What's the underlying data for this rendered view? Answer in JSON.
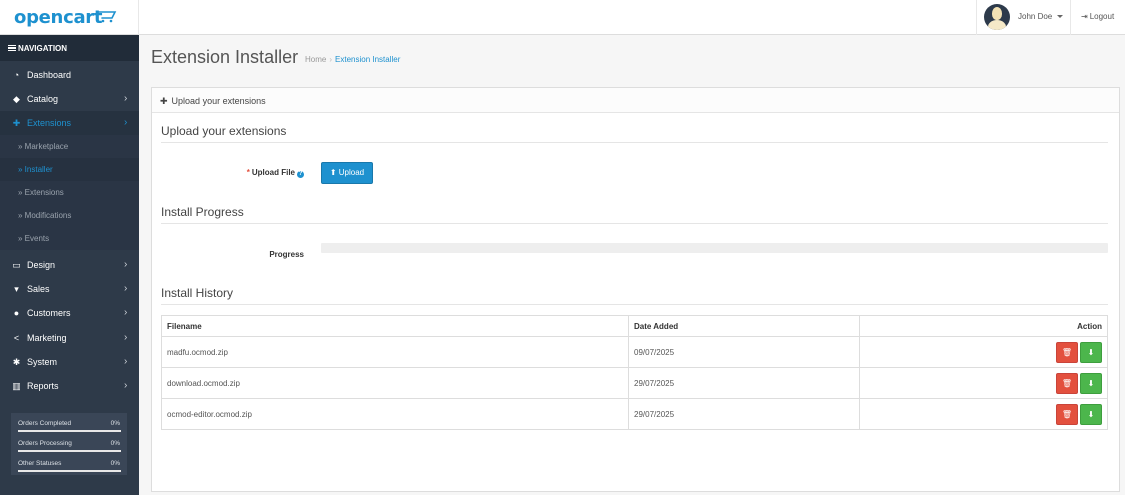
{
  "header": {
    "logo": "opencart",
    "user_name": "John Doe",
    "logout_label": "Logout"
  },
  "sidebar": {
    "nav_title": "NAVIGATION",
    "items": [
      {
        "label": "Dashboard",
        "icon": "dashboard-icon"
      },
      {
        "label": "Catalog",
        "icon": "tag-icon"
      },
      {
        "label": "Extensions",
        "icon": "puzzle-icon"
      },
      {
        "label": "Design",
        "icon": "monitor-icon"
      },
      {
        "label": "Sales",
        "icon": "cart-icon"
      },
      {
        "label": "Customers",
        "icon": "user-icon"
      },
      {
        "label": "Marketing",
        "icon": "share-icon"
      },
      {
        "label": "System",
        "icon": "cog-icon"
      },
      {
        "label": "Reports",
        "icon": "bar-chart-icon"
      }
    ],
    "sub_items": [
      {
        "label": "Marketplace"
      },
      {
        "label": "Installer"
      },
      {
        "label": "Extensions"
      },
      {
        "label": "Modifications"
      },
      {
        "label": "Events"
      }
    ],
    "stats": [
      {
        "label": "Orders Completed",
        "percent": "0%"
      },
      {
        "label": "Orders Processing",
        "percent": "0%"
      },
      {
        "label": "Other Statuses",
        "percent": "0%"
      }
    ]
  },
  "page": {
    "title": "Extension Installer",
    "breadcrumb": [
      "Home",
      "Extension Installer"
    ],
    "panel_heading": "Upload your extensions",
    "upload_section": "Upload your extensions",
    "upload_label": "Upload File",
    "upload_button": "Upload",
    "progress_section": "Install Progress",
    "progress_label": "Progress",
    "history_section": "Install History"
  },
  "history": {
    "columns": [
      "Filename",
      "Date Added",
      "Action"
    ],
    "rows": [
      {
        "filename": "madfu.ocmod.zip",
        "date": "09/07/2025"
      },
      {
        "filename": "download.ocmod.zip",
        "date": "29/07/2025"
      },
      {
        "filename": "ocmod-editor.ocmod.zip",
        "date": "29/07/2025"
      }
    ]
  },
  "colors": {
    "accent": "#1e91cf",
    "sidebar": "#2e3a49",
    "danger": "#e3503e",
    "success": "#4cb64c"
  }
}
